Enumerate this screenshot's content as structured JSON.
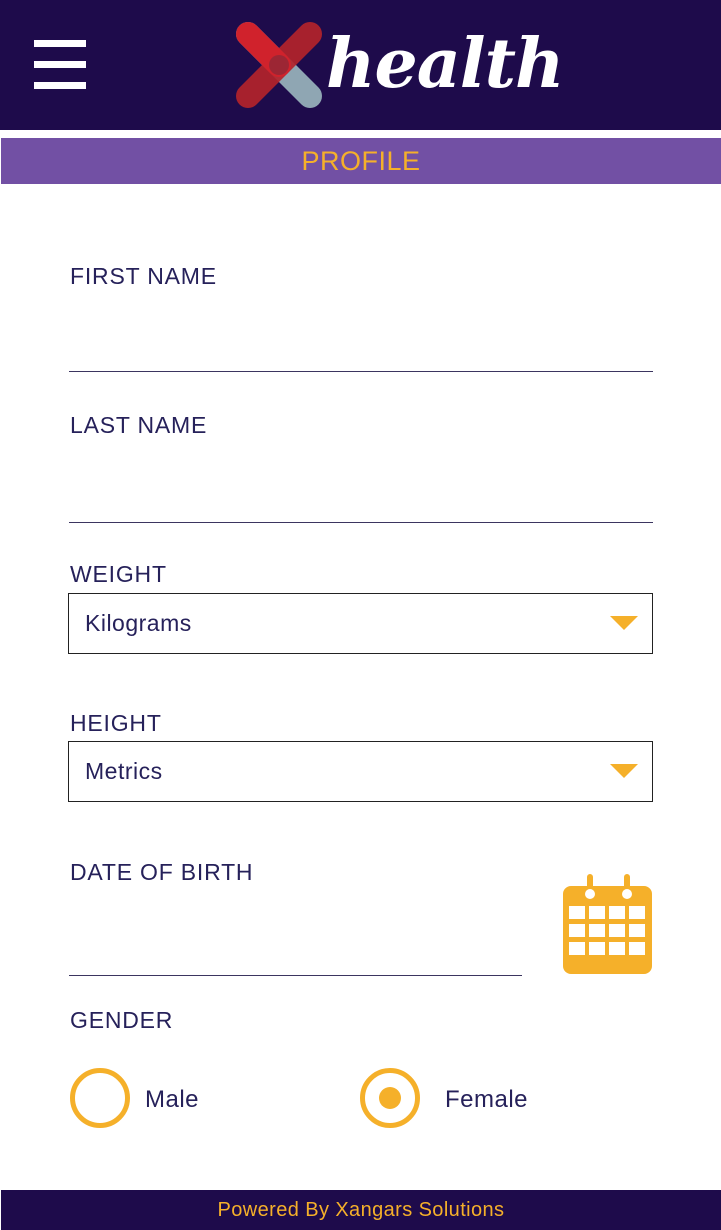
{
  "header": {
    "logo_text": "health",
    "menu_icon": "hamburger-menu-icon"
  },
  "page": {
    "title": "PROFILE"
  },
  "form": {
    "first_name": {
      "label": "FIRST NAME",
      "value": ""
    },
    "last_name": {
      "label": "LAST NAME",
      "value": ""
    },
    "weight": {
      "label": "WEIGHT",
      "selected": "Kilograms"
    },
    "height": {
      "label": "HEIGHT",
      "selected": "Metrics"
    },
    "date_of_birth": {
      "label": "DATE OF BIRTH",
      "value": "",
      "icon": "calendar-icon"
    },
    "gender": {
      "label": "GENDER",
      "options": [
        {
          "label": "Male",
          "selected": false
        },
        {
          "label": "Female",
          "selected": true
        }
      ]
    }
  },
  "footer": {
    "text": "Powered By Xangars Solutions"
  },
  "colors": {
    "header_bg": "#1e0b4b",
    "title_bar_bg": "#7250a4",
    "accent": "#f5b02a",
    "label_text": "#26215a"
  }
}
